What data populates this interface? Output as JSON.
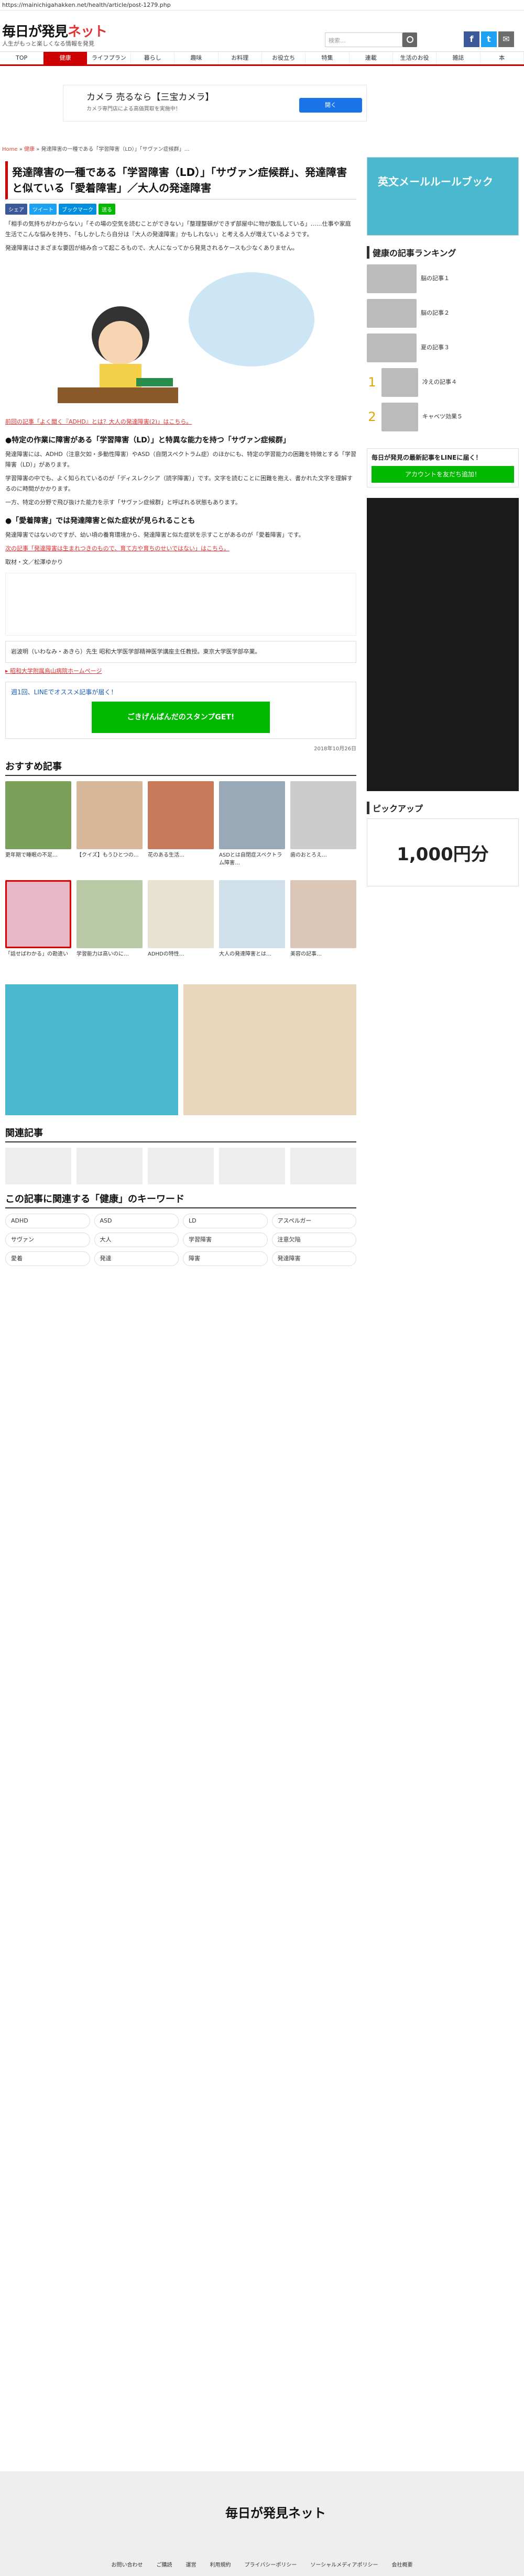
{
  "url": "https://mainichigahakken.net/health/article/post-1279.php",
  "header": {
    "logo": "毎日が発見",
    "logo_net": "ネット",
    "tagline": "人生がもっと楽しくなる情報を発見",
    "search_placeholder": "検索..."
  },
  "gnav": [
    "TOP",
    "健康",
    "ライフプラン",
    "暮らし",
    "趣味",
    "お料理",
    "お役立ち",
    "特集",
    "連載",
    "生活のお役",
    "雑誌",
    "本"
  ],
  "topad": {
    "title": "カメラ 売るなら【三宝カメラ】",
    "text": "カメラ専門店による高価買取を実施中！",
    "button": "開く"
  },
  "breadcrumb": [
    "Home",
    "健康",
    "発達障害の一種である「学習障害（LD）」「サヴァン症候群」…"
  ],
  "article": {
    "title": "発達障害の一種である「学習障害（LD）」「サヴァン症候群」、発達障害と似ている「愛着障害」／大人の発達障害",
    "share": [
      "シェア",
      "ツイート",
      "ブックマーク",
      "送る"
    ],
    "p1": "「相手の気持ちがわからない」「その場の空気を読むことができない」「整理整頓ができず部屋中に物が散乱している」……仕事や家庭生活でこんな悩みを持ち、「もしかしたら自分は『大人の発達障害』かもしれない」と考える人が増えているようです。",
    "p2": "発達障害はさまざまな要因が絡み合って起こるもので、大人になってから発見されるケースも少なくありません。",
    "link1": "前回の記事「よく聞く『ADHD』とは？大人の発達障害(2)」はこちら。",
    "h1": "●特定の作業に障害がある「学習障害（LD）」と特異な能力を持つ「サヴァン症候群」",
    "p3": "発達障害には、ADHD（注意欠如・多動性障害）やASD（自閉スペクトラム症）のほかにも、特定の学習能力の困難を特徴とする「学習障害（LD）」があります。",
    "p4": "学習障害の中でも、よく知られているのが「ディスレクシア（読字障害）」です。文字を読むことに困難を抱え、書かれた文字を理解するのに時間がかかります。",
    "p5": "一方、特定の分野で飛び抜けた能力を示す「サヴァン症候群」と呼ばれる状態もあります。",
    "h2": "●「愛着障害」では発達障害と似た症状が見られることも",
    "p6": "発達障害ではないのですが、幼い頃の養育環境から、発達障害と似た症状を示すことがあるのが「愛着障害」です。",
    "link2": "次の記事「発達障害は生まれつきのもので、育て方や育ちのせいではない」はこちら。",
    "credit": "取材・文／松澤ゆかり",
    "profile": "岩波明（いわなみ・あきら）先生 昭和大学医学部精神医学講座主任教授。東京大学医学部卒業。",
    "hospital_link": "▸ 昭和大学附属烏山病院ホームページ",
    "line_text": "週1回、LINEでオススメ記事が届く！",
    "line_btn": "ごきげんぱんだのスタンプGET!",
    "date": "2018年10月26日"
  },
  "recommend": {
    "title": "おすすめ記事",
    "items": [
      "更年期で睡眠の不足…",
      "【クイズ】もうひとつの…",
      "花のある生活…",
      "ASDとは自閉症スペクトラム障害…",
      "歯のおとろえ…",
      "「話せばわかる」の勘違い",
      "学習能力は高いのに…",
      "ADHDの特性…",
      "大人の発達障害とは…",
      "美容の記事…"
    ]
  },
  "related": {
    "title": "関連記事"
  },
  "keywords": {
    "title": "この記事に関連する「健康」のキーワード",
    "items": [
      "ADHD",
      "ASD",
      "LD",
      "アスペルガー",
      "サヴァン",
      "大人",
      "学習障害",
      "注意欠陥",
      "愛着",
      "発達",
      "障害",
      "発達障害"
    ]
  },
  "sidebar": {
    "ad_title": "英文メールルールブック",
    "ranking_title": "健康の記事ランキング",
    "ranking": [
      "脳の記事１",
      "脳の記事２",
      "夏の記事３",
      "冷えの記事４",
      "キャベツ効果５"
    ],
    "line_title": "毎日が発見の最新記事をLINEに届く！",
    "line_btn": "アカウントを友だち追加！",
    "pickup": "ピックアップ",
    "coupon": "1,000円分"
  },
  "footer": {
    "logo": "毎日が発見ネット",
    "links": [
      "お問い合わせ",
      "ご購読",
      "運営",
      "利用規約",
      "プライバシーポリシー",
      "ソーシャルメディアポリシー",
      "会社概要"
    ]
  }
}
